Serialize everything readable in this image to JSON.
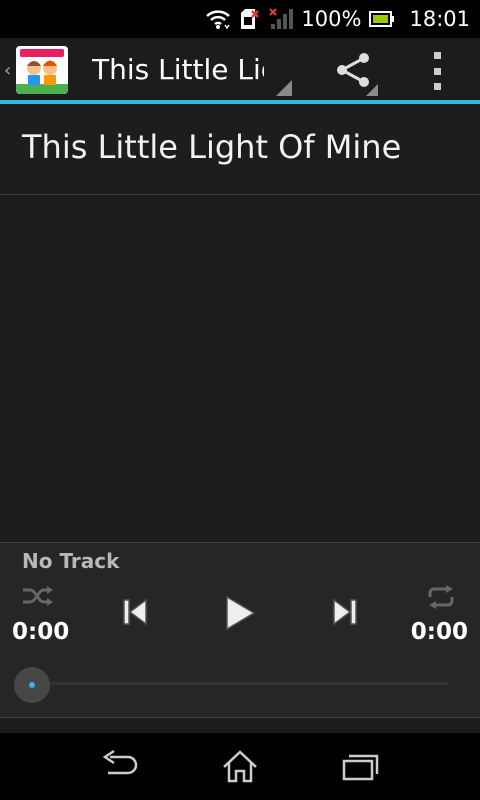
{
  "status_bar": {
    "battery_percent": "100%",
    "time": "18:01"
  },
  "action_bar": {
    "title": "This Little Light Of Mine"
  },
  "song": {
    "title": "This Little Light Of Mine"
  },
  "player": {
    "track_label": "No Track",
    "elapsed": "0:00",
    "duration": "0:00",
    "progress": 0
  },
  "colors": {
    "accent": "#33b5e5",
    "background": "#1d1d1d",
    "player_background": "#262626"
  },
  "icons": [
    "wifi-icon",
    "sim-error-icon",
    "signal-icon",
    "battery-icon",
    "app-icon",
    "share-icon",
    "overflow-menu-icon",
    "shuffle-icon",
    "previous-icon",
    "play-icon",
    "next-icon",
    "repeat-icon",
    "back-icon",
    "home-icon",
    "recent-apps-icon"
  ]
}
